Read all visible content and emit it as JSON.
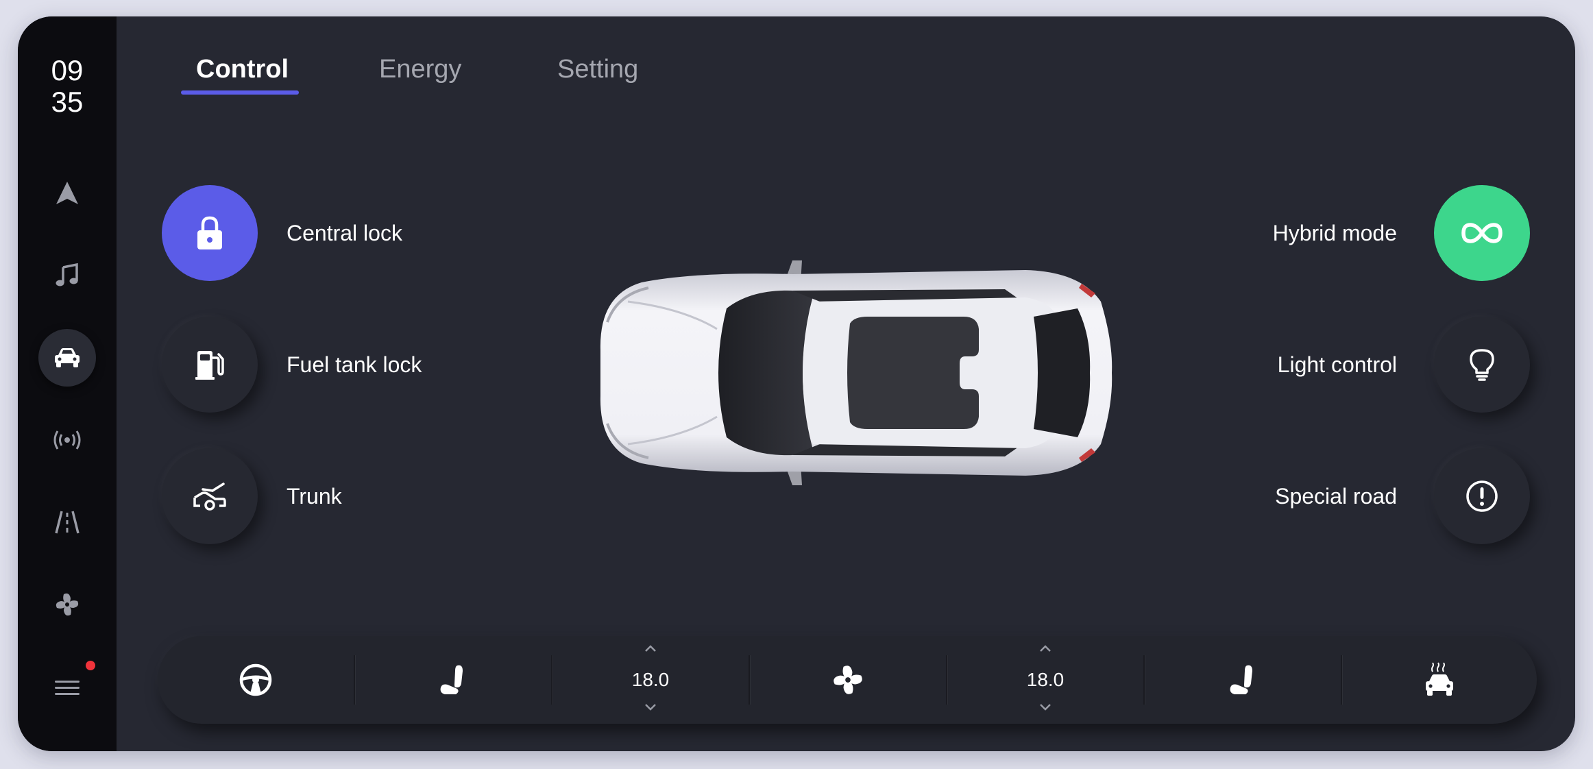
{
  "clock": {
    "hours": "09",
    "minutes": "35"
  },
  "sidebar": {
    "items": [
      {
        "name": "navigation",
        "icon": "navigation-arrow-icon",
        "active": false
      },
      {
        "name": "music",
        "icon": "music-note-icon",
        "active": false
      },
      {
        "name": "vehicle",
        "icon": "car-icon",
        "active": true
      },
      {
        "name": "connectivity",
        "icon": "broadcast-icon",
        "active": false
      },
      {
        "name": "road",
        "icon": "road-icon",
        "active": false
      },
      {
        "name": "climate",
        "icon": "fan-icon",
        "active": false
      },
      {
        "name": "menu",
        "icon": "menu-icon",
        "active": false,
        "notification": true
      }
    ]
  },
  "tabs": [
    {
      "label": "Control",
      "active": true
    },
    {
      "label": "Energy",
      "active": false
    },
    {
      "label": "Setting",
      "active": false
    }
  ],
  "controls": {
    "left": [
      {
        "label": "Central lock",
        "icon": "lock-icon",
        "active": true
      },
      {
        "label": "Fuel tank lock",
        "icon": "fuel-pump-icon",
        "active": false
      },
      {
        "label": "Trunk",
        "icon": "trunk-icon",
        "active": false
      }
    ],
    "right": [
      {
        "label": "Hybrid mode",
        "icon": "infinity-icon",
        "active": true
      },
      {
        "label": "Light control",
        "icon": "lightbulb-icon",
        "active": false
      },
      {
        "label": "Special road",
        "icon": "alert-circle-icon",
        "active": false
      }
    ]
  },
  "climate_bar": {
    "steering_heat_icon": "steering-wheel-icon",
    "driver_seat_icon": "seat-icon",
    "driver_temp": "18.0",
    "fan_icon": "fan-icon",
    "passenger_temp": "18.0",
    "passenger_seat_icon": "seat-icon",
    "defrost_icon": "car-heat-icon"
  },
  "colors": {
    "accent": "#5b5ce8",
    "hybrid": "#3dd68c",
    "background": "#262832",
    "rail": "#0c0c10",
    "notification": "#f0333b"
  }
}
